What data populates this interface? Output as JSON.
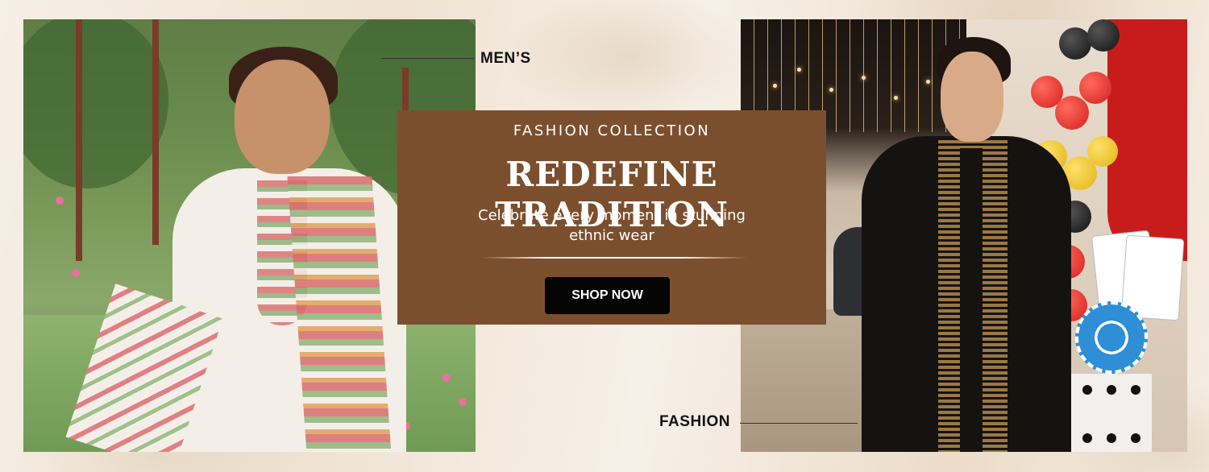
{
  "banner": {
    "label_top": "MEN’S",
    "label_bottom": "FASHION",
    "eyebrow": "FASHION COLLECTION",
    "headline": "REDEFINE TRADITION",
    "subline": "Celebrate every moment in stunning ethnic wear",
    "cta_label": "SHOP NOW"
  },
  "colors": {
    "panel_brown": "#7b4f2e",
    "button_black": "#050505",
    "background_cream": "#f6efe6"
  }
}
